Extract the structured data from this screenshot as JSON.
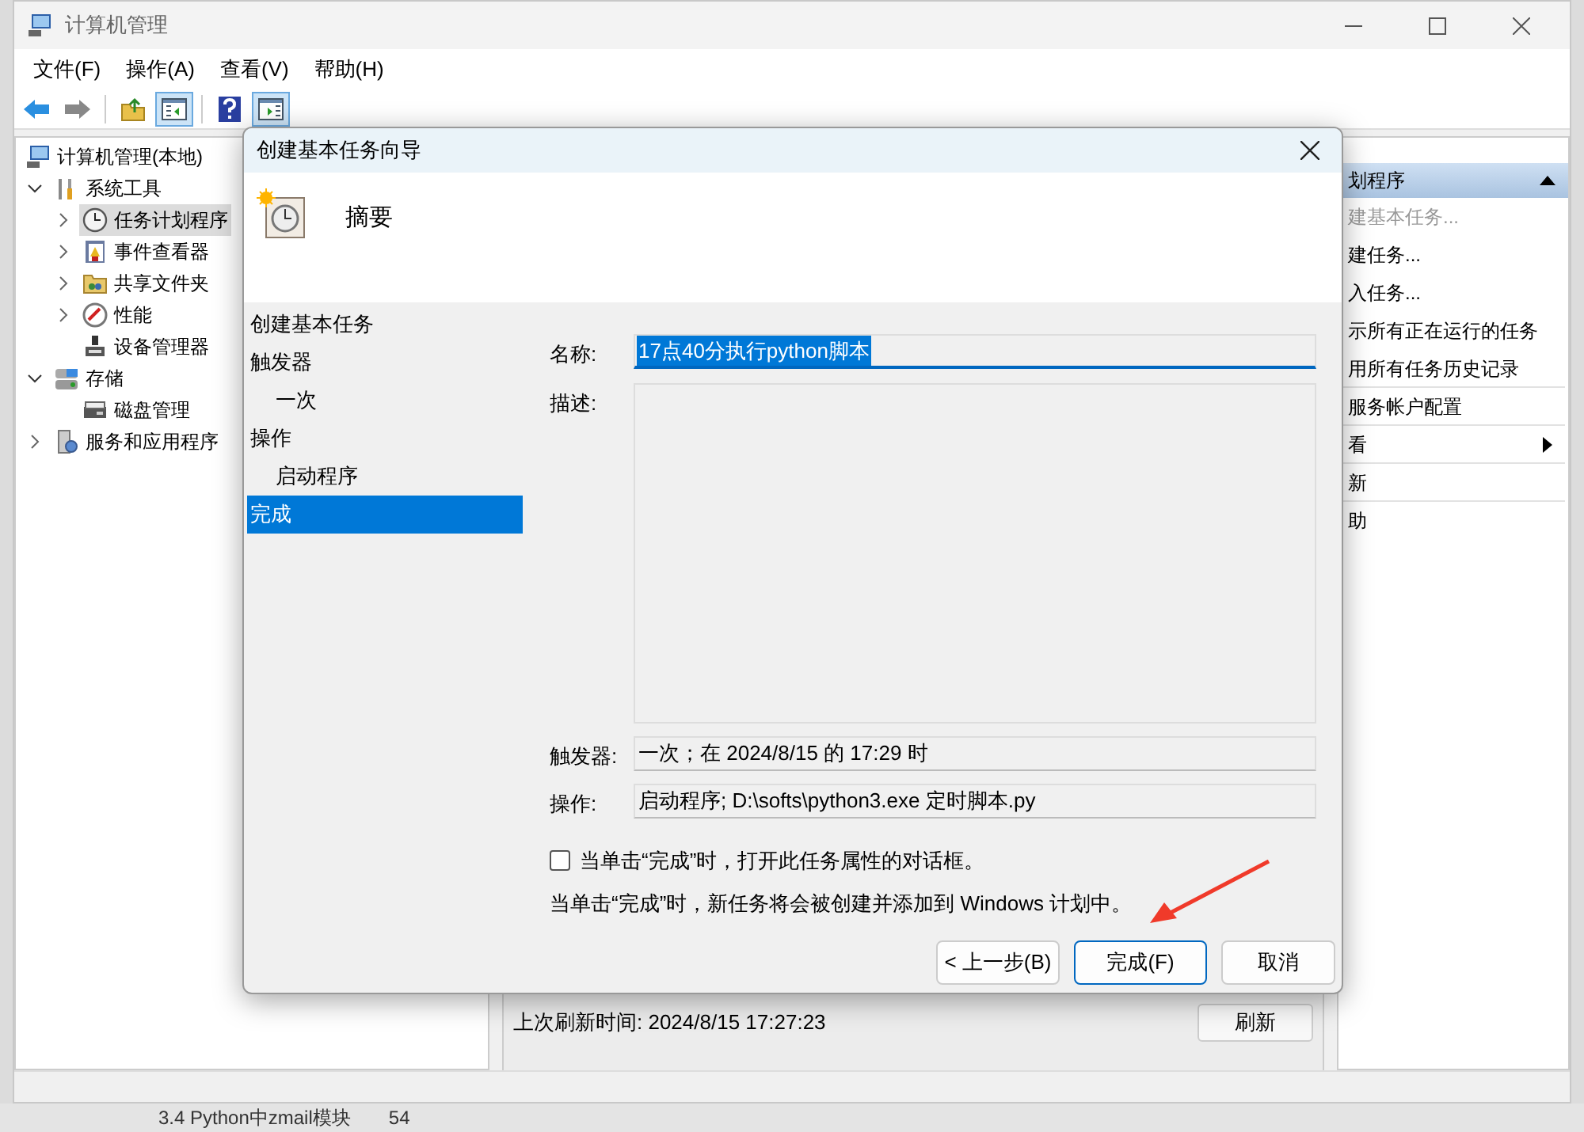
{
  "window": {
    "title": "计算机管理"
  },
  "menu": [
    "文件(F)",
    "操作(A)",
    "查看(V)",
    "帮助(H)"
  ],
  "toolbar": [
    {
      "kind": "back",
      "on": false
    },
    {
      "kind": "forward",
      "on": false
    },
    {
      "kind": "sep"
    },
    {
      "kind": "up",
      "on": false
    },
    {
      "kind": "tree",
      "on": true
    },
    {
      "kind": "sep"
    },
    {
      "kind": "help",
      "on": false
    },
    {
      "kind": "pane",
      "on": true
    }
  ],
  "tree": [
    {
      "label": "计算机管理(本地)",
      "kind": "computer",
      "selected": false,
      "children": [
        {
          "label": "系统工具",
          "kind": "tools",
          "expandable": true,
          "expanded": true,
          "selected": false,
          "children": [
            {
              "label": "任务计划程序",
              "kind": "clock",
              "expandable": true,
              "expanded": false,
              "selected": true
            },
            {
              "label": "事件查看器",
              "kind": "log",
              "expandable": true,
              "expanded": false,
              "selected": false
            },
            {
              "label": "共享文件夹",
              "kind": "folder",
              "expandable": true,
              "expanded": false,
              "selected": false
            },
            {
              "label": "性能",
              "kind": "gauge",
              "expandable": true,
              "expanded": false,
              "selected": false
            },
            {
              "label": "设备管理器",
              "kind": "device",
              "expandable": false,
              "selected": false
            }
          ]
        },
        {
          "label": "存储",
          "kind": "storage",
          "expandable": true,
          "expanded": true,
          "selected": false,
          "children": [
            {
              "label": "磁盘管理",
              "kind": "disk",
              "expandable": false,
              "selected": false
            }
          ]
        },
        {
          "label": "服务和应用程序",
          "kind": "services",
          "expandable": true,
          "expanded": false,
          "selected": false
        }
      ]
    }
  ],
  "center": {
    "status": "上次刷新时间: 2024/8/15 17:27:23",
    "refresh_button": "刷新"
  },
  "actions": {
    "header": "划程序",
    "items": [
      {
        "label": "建基本任务...",
        "disabled": true,
        "submenu": false,
        "separator_after": false
      },
      {
        "label": "建任务...",
        "disabled": false,
        "submenu": false,
        "separator_after": false
      },
      {
        "label": "入任务...",
        "disabled": false,
        "submenu": false,
        "separator_after": false
      },
      {
        "label": "示所有正在运行的任务",
        "disabled": false,
        "submenu": false,
        "separator_after": false
      },
      {
        "label": "用所有任务历史记录",
        "disabled": false,
        "submenu": false,
        "separator_after": true
      },
      {
        "label": "服务帐户配置",
        "disabled": false,
        "submenu": false,
        "separator_after": true
      },
      {
        "label": "看",
        "disabled": false,
        "submenu": true,
        "separator_after": true
      },
      {
        "label": "新",
        "disabled": false,
        "submenu": false,
        "separator_after": true
      },
      {
        "label": "助",
        "disabled": false,
        "submenu": false,
        "separator_after": false
      }
    ]
  },
  "dialog": {
    "title": "创建基本任务向导",
    "heading": "摘要",
    "steps": [
      {
        "label": "创建基本任务",
        "indented": false,
        "selected": false
      },
      {
        "label": "触发器",
        "indented": false,
        "selected": false
      },
      {
        "label": "一次",
        "indented": true,
        "selected": false
      },
      {
        "label": "操作",
        "indented": false,
        "selected": false
      },
      {
        "label": "启动程序",
        "indented": true,
        "selected": false
      },
      {
        "label": "完成",
        "indented": false,
        "selected": true
      }
    ],
    "fields": [
      {
        "label": "名称:",
        "kind": "name",
        "value": "17点40分执行python脚本"
      },
      {
        "label": "描述:",
        "kind": "multiline"
      },
      {
        "label": "触发器:",
        "kind": "readonly",
        "value": "一次；在 2024/8/15 的 17:29 时"
      },
      {
        "label": "操作:",
        "kind": "readonly",
        "value": "启动程序; D:\\softs\\python3.exe 定时脚本.py"
      }
    ],
    "open_properties": {
      "label": "当单击“完成”时，打开此任务属性的对话框。",
      "checked": false
    },
    "note": "当单击“完成”时，新任务将会被创建并添加到 Windows 计划中。",
    "buttons": [
      {
        "label": "< 上一步(B)",
        "default": false
      },
      {
        "label": "完成(F)",
        "default": true
      },
      {
        "label": "取消",
        "default": false
      }
    ]
  },
  "background_list": {
    "title": "3.4 Python中zmail模块",
    "count": "54"
  }
}
